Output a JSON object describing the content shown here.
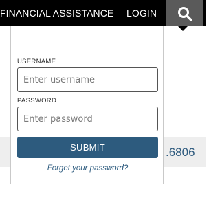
{
  "header": {
    "nav_financial": "FINANCIAL ASSISTANCE",
    "nav_login": "LOGIN",
    "search_icon": "search-icon"
  },
  "background": {
    "phone_fragment": ".6806"
  },
  "login": {
    "username_label": "USERNAME",
    "username_placeholder": "Enter username",
    "username_value": "",
    "password_label": "PASSWORD",
    "password_placeholder": "Enter password",
    "password_value": "",
    "submit_label": "SUBMIT",
    "forgot_label": "Forget your password?"
  },
  "colors": {
    "topbar": "#000000",
    "search_button": "#5a5a5a",
    "accent": "#2d5b7e"
  }
}
